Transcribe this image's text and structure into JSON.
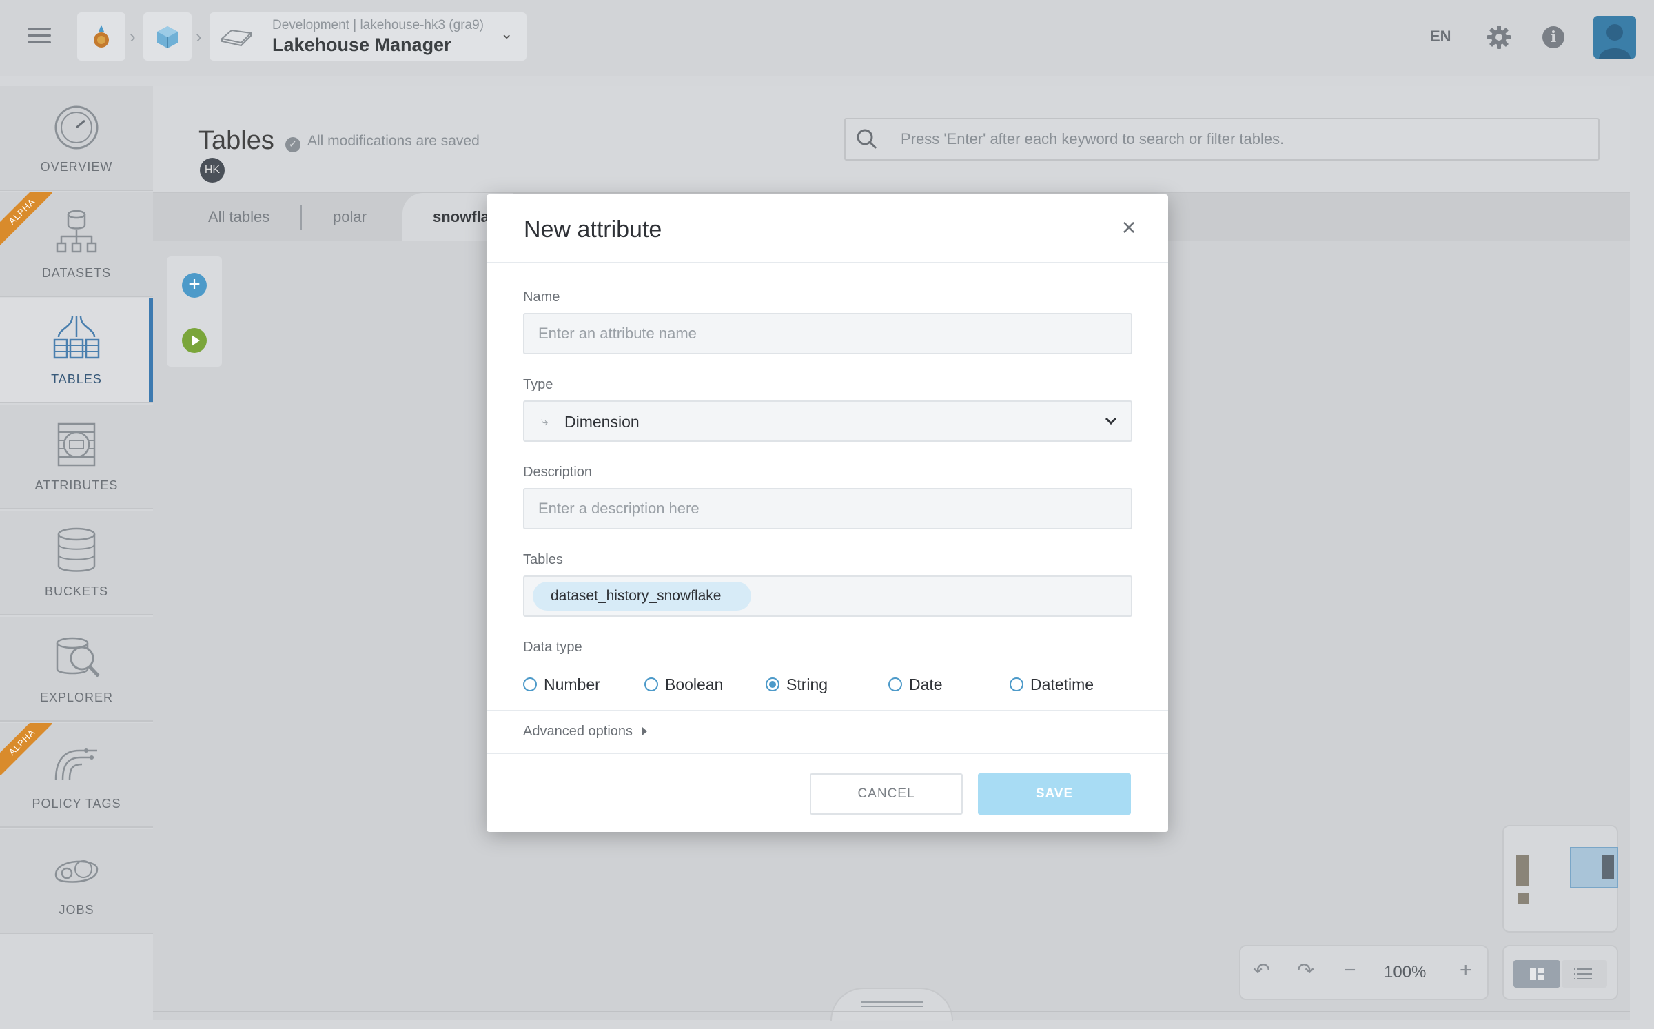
{
  "topbar": {
    "project_sub": "Development  |  lakehouse-hk3 (gra9)",
    "project_title": "Lakehouse Manager",
    "language": "EN",
    "icons": [
      "menu-icon",
      "app-logo-icon",
      "cube-icon",
      "lakehouse-icon",
      "chevron-down-icon",
      "gear-icon",
      "info-icon",
      "user-avatar"
    ]
  },
  "sidebar": {
    "items": [
      {
        "label": "OVERVIEW",
        "icon": "gauge-icon",
        "alpha": false,
        "active": false
      },
      {
        "label": "DATASETS",
        "icon": "database-tree-icon",
        "alpha": true,
        "active": false
      },
      {
        "label": "TABLES",
        "icon": "tables-icon",
        "alpha": false,
        "active": true
      },
      {
        "label": "ATTRIBUTES",
        "icon": "attributes-icon",
        "alpha": false,
        "active": false
      },
      {
        "label": "BUCKETS",
        "icon": "bucket-icon",
        "alpha": false,
        "active": false
      },
      {
        "label": "EXPLORER",
        "icon": "explorer-icon",
        "alpha": false,
        "active": false
      },
      {
        "label": "POLICY TAGS",
        "icon": "policy-tags-icon",
        "alpha": true,
        "active": false
      },
      {
        "label": "JOBS",
        "icon": "jobs-icon",
        "alpha": false,
        "active": false
      }
    ],
    "alpha_label": "ALPHA"
  },
  "header": {
    "title": "Tables",
    "saved_status": "All modifications are saved",
    "user_initials": "HK",
    "search_placeholder": "Press 'Enter' after each keyword to search or filter tables."
  },
  "tabs": [
    {
      "label": "All tables"
    },
    {
      "label": "polar"
    },
    {
      "label": "snowfla"
    }
  ],
  "canvas": {
    "zoom": "100%"
  },
  "modal": {
    "title": "New attribute",
    "name_label": "Name",
    "name_placeholder": "Enter an attribute name",
    "type_label": "Type",
    "type_value": "Dimension",
    "description_label": "Description",
    "description_placeholder": "Enter a description here",
    "tables_label": "Tables",
    "table_tag": "dataset_history_snowflake",
    "datatype_label": "Data type",
    "datatypes": [
      {
        "label": "Number",
        "checked": false
      },
      {
        "label": "Boolean",
        "checked": false
      },
      {
        "label": "String",
        "checked": true
      },
      {
        "label": "Date",
        "checked": false
      },
      {
        "label": "Datetime",
        "checked": false
      }
    ],
    "advanced_label": "Advanced options",
    "cancel_label": "CANCEL",
    "save_label": "SAVE"
  },
  "colors": {
    "accent": "#4d9ac9",
    "alpha_badge": "#d98b2c",
    "active_nav": "#3d7ab0",
    "save_disabled": "#a8dcf4"
  }
}
